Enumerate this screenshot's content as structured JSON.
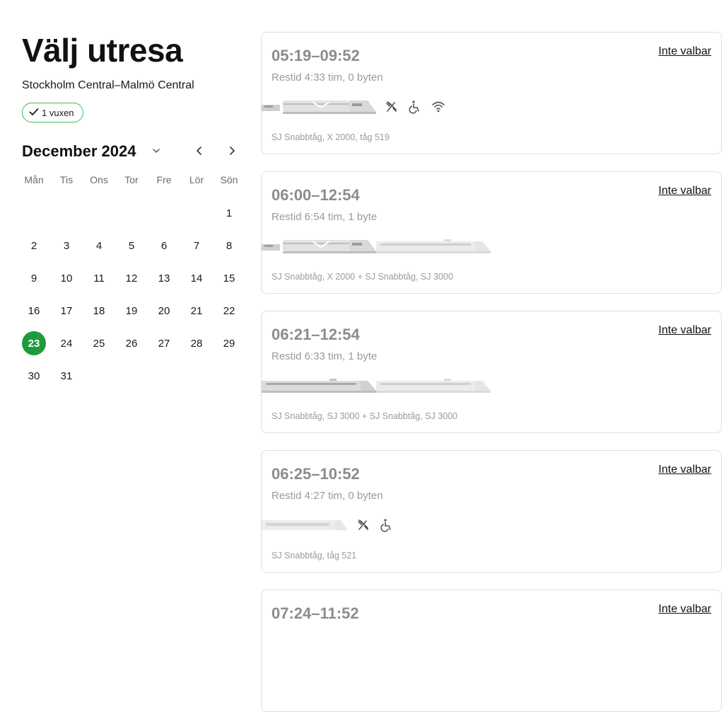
{
  "header": {
    "title": "Välj utresa",
    "route": "Stockholm Central–Malmö Central",
    "passengers": "1 vuxen"
  },
  "calendar": {
    "month_label": "December 2024",
    "weekdays": [
      "Mån",
      "Tis",
      "Ons",
      "Tor",
      "Fre",
      "Lör",
      "Sön"
    ],
    "weeks": [
      [
        "",
        "",
        "",
        "",
        "",
        "",
        "1"
      ],
      [
        "2",
        "3",
        "4",
        "5",
        "6",
        "7",
        "8"
      ],
      [
        "9",
        "10",
        "11",
        "12",
        "13",
        "14",
        "15"
      ],
      [
        "16",
        "17",
        "18",
        "19",
        "20",
        "21",
        "22"
      ],
      [
        "23",
        "24",
        "25",
        "26",
        "27",
        "28",
        "29"
      ],
      [
        "30",
        "31",
        "",
        "",
        "",
        "",
        ""
      ]
    ],
    "selected_day": "23"
  },
  "departures": [
    {
      "times": "05:19–09:52",
      "duration": "Restid 4:33 tim, 0 byten",
      "status": "Inte valbar",
      "operator": "SJ Snabbtåg, X 2000, tåg 519",
      "trains": [
        "x2000"
      ],
      "amenities": [
        "restaurant-icon",
        "wheelchair-icon",
        "wifi-icon"
      ]
    },
    {
      "times": "06:00–12:54",
      "duration": "Restid 6:54 tim, 1 byte",
      "status": "Inte valbar",
      "operator": "SJ Snabbtåg, X 2000 + SJ Snabbtåg, SJ 3000",
      "trains": [
        "x2000",
        "sj3000-fade"
      ],
      "amenities": []
    },
    {
      "times": "06:21–12:54",
      "duration": "Restid 6:33 tim, 1 byte",
      "status": "Inte valbar",
      "operator": "SJ Snabbtåg, SJ 3000 + SJ Snabbtåg, SJ 3000",
      "trains": [
        "sj3000",
        "sj3000-fade"
      ],
      "amenities": []
    },
    {
      "times": "06:25–10:52",
      "duration": "Restid 4:27 tim, 0 byten",
      "status": "Inte valbar",
      "operator": "SJ Snabbtåg, tåg 521",
      "trains": [
        "generic"
      ],
      "amenities": [
        "restaurant-icon",
        "wheelchair-icon"
      ]
    },
    {
      "times": "07:24–11:52",
      "duration": "",
      "status": "Inte valbar",
      "operator": "",
      "trains": [],
      "amenities": []
    }
  ],
  "colors": {
    "accent": "#1e9a3a",
    "chip_border": "#3dbb55",
    "muted_text": "#8c8c8c",
    "card_border": "#dedede"
  }
}
